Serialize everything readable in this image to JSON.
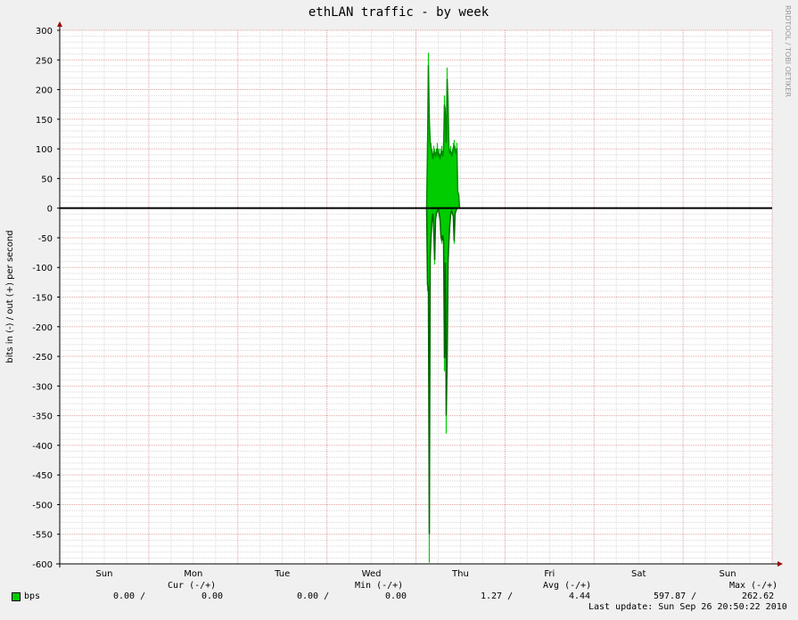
{
  "chart_data": {
    "type": "line",
    "title": "ethLAN traffic - by week",
    "ylabel": "bits in (-) / out (+) per second",
    "xlabel": "",
    "watermark": "RRDTOOL / TOBI OETIKER",
    "ylim": [
      -600,
      300
    ],
    "yticks": [
      300,
      250,
      200,
      150,
      100,
      50,
      0,
      -50,
      -100,
      -150,
      -200,
      -250,
      -300,
      -350,
      -400,
      -450,
      -500,
      -550,
      -600
    ],
    "xticks": [
      "Sun",
      "Mon",
      "Tue",
      "Wed",
      "Thu",
      "Fri",
      "Sat",
      "Sun"
    ],
    "grid": true,
    "colors": {
      "background": "#ffffff",
      "outer": "#f0f0f0",
      "minor_grid": "#d8d8d8",
      "major_grid": "#e0a0a0",
      "zero_line": "#000000",
      "out_color": "#00cc00",
      "in_color": "#00cc00",
      "out_dark": "#008800",
      "in_dark": "#006600"
    },
    "series": [
      {
        "name": "out",
        "x_days": [
          4.12,
          4.13,
          4.14,
          4.15,
          4.16,
          4.17,
          4.18,
          4.19,
          4.2,
          4.21,
          4.22,
          4.23,
          4.24,
          4.25,
          4.26,
          4.27,
          4.28,
          4.29,
          4.3,
          4.31,
          4.32,
          4.33,
          4.34,
          4.35,
          4.36,
          4.37,
          4.38,
          4.39,
          4.4,
          4.41,
          4.42,
          4.43,
          4.44,
          4.45,
          4.46,
          4.47,
          4.48,
          4.49
        ],
        "values": [
          0,
          110,
          262,
          160,
          120,
          110,
          100,
          90,
          105,
          100,
          95,
          100,
          110,
          95,
          100,
          90,
          100,
          105,
          95,
          110,
          190,
          170,
          120,
          237,
          190,
          110,
          100,
          105,
          95,
          100,
          110,
          115,
          105,
          100,
          110,
          30,
          25,
          0
        ]
      },
      {
        "name": "in",
        "x_days": [
          4.12,
          4.13,
          4.14,
          4.15,
          4.16,
          4.17,
          4.18,
          4.19,
          4.2,
          4.21,
          4.22,
          4.23,
          4.24,
          4.25,
          4.26,
          4.27,
          4.28,
          4.29,
          4.3,
          4.31,
          4.32,
          4.33,
          4.34,
          4.35,
          4.36,
          4.37,
          4.38,
          4.39,
          4.4,
          4.41,
          4.42,
          4.43,
          4.44,
          4.45,
          4.46,
          4.47,
          4.48,
          4.49
        ],
        "values": [
          0,
          -140,
          -145,
          -598,
          -90,
          -50,
          -20,
          -10,
          -40,
          -95,
          -20,
          -10,
          -5,
          0,
          -10,
          -20,
          -50,
          -60,
          -50,
          -60,
          -275,
          -100,
          -380,
          -280,
          -100,
          -60,
          -30,
          -10,
          -5,
          -10,
          -15,
          -60,
          -10,
          -5,
          0,
          0,
          0,
          0
        ]
      }
    ],
    "legend": {
      "cur_header": "Cur (-/+)",
      "min_header": "Min (-/+)",
      "avg_header": "Avg (-/+)",
      "max_header": "Max (-/+)",
      "series_label": "bps",
      "cur_in": "0.00 /",
      "cur_out": "0.00",
      "min_in": "0.00 /",
      "min_out": "0.00",
      "avg_in": "1.27 /",
      "avg_out": "4.44",
      "max_in": "597.87 /",
      "max_out": "262.62"
    },
    "last_update": "Last update: Sun Sep 26 20:50:22 2010"
  }
}
